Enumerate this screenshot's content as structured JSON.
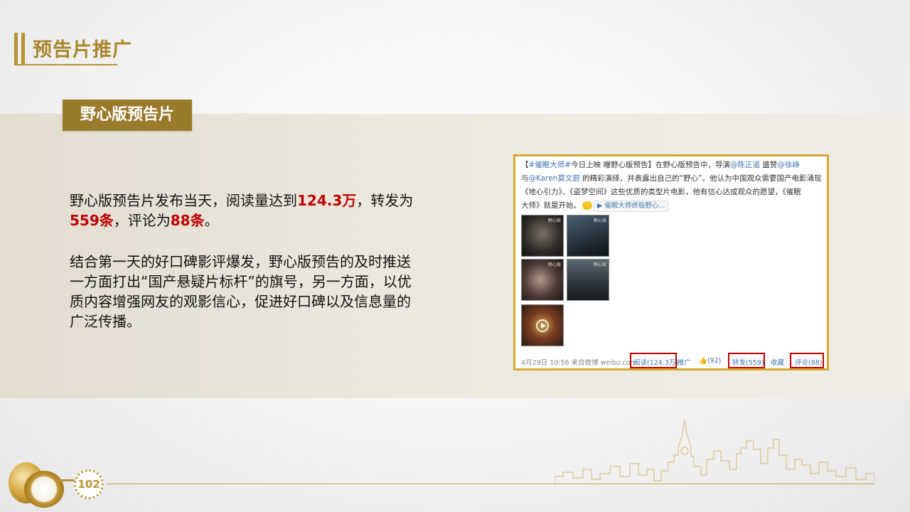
{
  "header": {
    "title": "预告片推广"
  },
  "subtitle": "野心版预告片",
  "paragraph1": {
    "t1": "野心版预告片发布当天，阅读量达到",
    "read": "124.3万",
    "t2": "，转发为",
    "forward": "559条",
    "t3": "，评论为",
    "comment": "88条",
    "t4": "。"
  },
  "paragraph2": "结合第一天的好口碑影评爆发，野心版预告的及时推送一方面打出“国产悬疑片标杆”的旗号，另一方面，以优质内容增强网友的观影信心，促进好口碑以及信息量的广泛传播。",
  "weibo": {
    "line1_a": "【",
    "line1_tag": "#催眠大师#",
    "line1_b": "今日上映 曝野心版预告】在野心版预告中，导演",
    "line1_mention1": "@陈正道",
    "line1_c": " 盛赞",
    "line1_mention2": "@徐峥",
    "line2_a": "与",
    "line2_mention": "@Karen莫文蔚",
    "line2_b": " 的精彩演绎，并表露出自己的“野心”。他认为中国观众需要国产电影涌现",
    "line3": "《地心引力》、《盗梦空间》这些优质的类型片电影，他有信心达成观众的愿望，《催眠",
    "line4_a": "大师》就是开始。",
    "video_chip": "催眠大师终极野心...",
    "image_tag": "野心版",
    "footer_meta": "4月29日 10:56  来自微博 weibo.com",
    "read_count": "阅读(124.3万)",
    "promote": "推广",
    "like": "(92)",
    "forward": "转发(559)",
    "favorite": "收藏",
    "comment": "评论(88)"
  },
  "page_number": "102",
  "colors": {
    "accent": "#b8932f",
    "highlight": "#c00000"
  }
}
